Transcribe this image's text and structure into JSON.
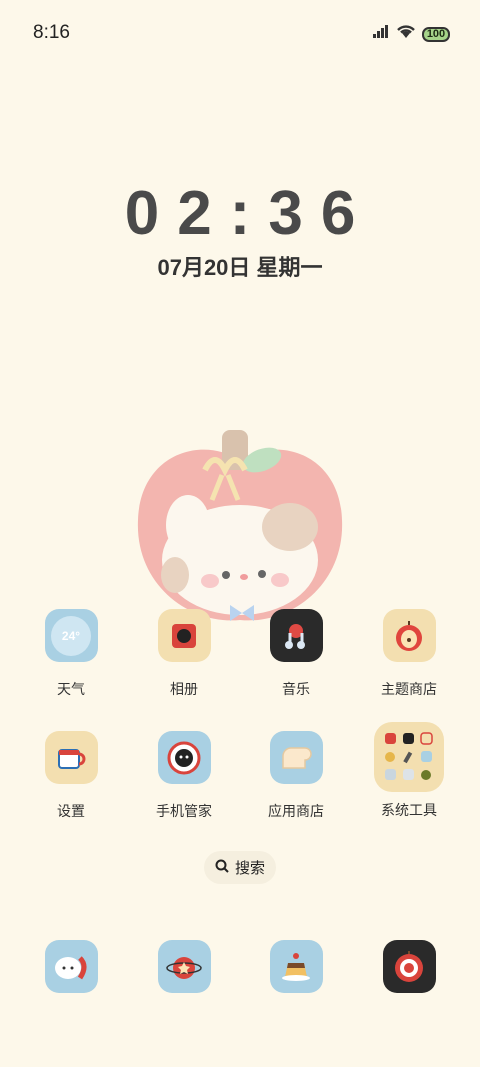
{
  "status_bar": {
    "time": "8:16",
    "battery": "100"
  },
  "lockclock": {
    "d1": "0",
    "d2": "2",
    "sep": ":",
    "d3": "3",
    "d4": "6",
    "date": "07月20日 星期一"
  },
  "apps": [
    {
      "label": "天气",
      "icon": "weather-24-icon",
      "icon_text": "24°"
    },
    {
      "label": "相册",
      "icon": "gallery-cat-frame-icon"
    },
    {
      "label": "音乐",
      "icon": "music-note-icon"
    },
    {
      "label": "主题商店",
      "icon": "apple-theme-icon"
    },
    {
      "label": "设置",
      "icon": "teacup-icon"
    },
    {
      "label": "手机管家",
      "icon": "cat-shield-icon"
    },
    {
      "label": "应用商店",
      "icon": "bread-icon"
    },
    {
      "label": "系统工具",
      "icon": "tools-folder-icon"
    }
  ],
  "search": {
    "label": "搜索"
  },
  "dock": [
    {
      "icon": "phone-bunny-icon"
    },
    {
      "icon": "tomato-planet-icon"
    },
    {
      "icon": "pudding-icon"
    },
    {
      "icon": "target-apple-icon"
    }
  ],
  "colors": {
    "background": "#fdf8ea",
    "icon_blue": "#a9d0e3",
    "icon_cream": "#f3dfb0",
    "icon_dark": "#2a2a2a"
  }
}
